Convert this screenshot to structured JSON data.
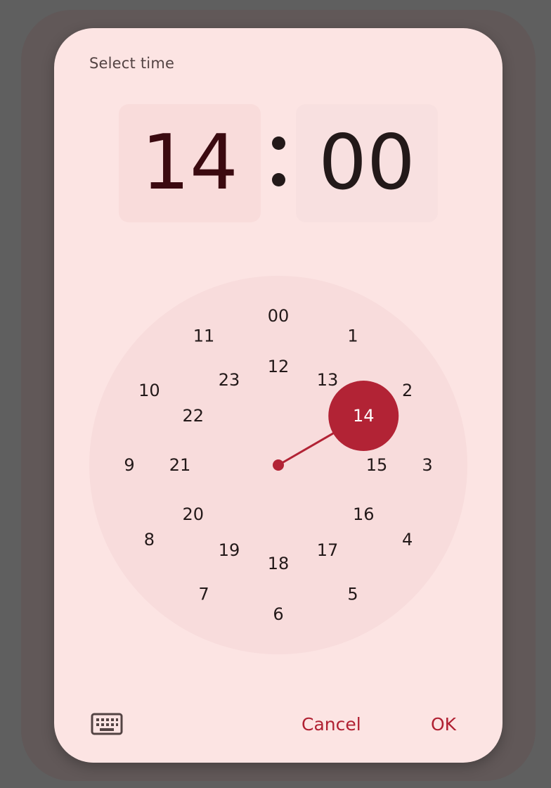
{
  "dialog": {
    "headline": "Select time",
    "hour": "14",
    "minute": "00",
    "separator": ":"
  },
  "clock": {
    "selected": "14",
    "outer_ring": [
      "00",
      "1",
      "2",
      "3",
      "4",
      "5",
      "6",
      "7",
      "8",
      "9",
      "10",
      "11"
    ],
    "inner_ring": [
      "12",
      "13",
      "14",
      "15",
      "16",
      "17",
      "18",
      "19",
      "20",
      "21",
      "22",
      "23"
    ],
    "colors": {
      "face": "#f8dcdc",
      "accent": "#b22335"
    }
  },
  "footer": {
    "mode_icon": "keyboard-icon",
    "cancel_label": "Cancel",
    "ok_label": "OK"
  }
}
